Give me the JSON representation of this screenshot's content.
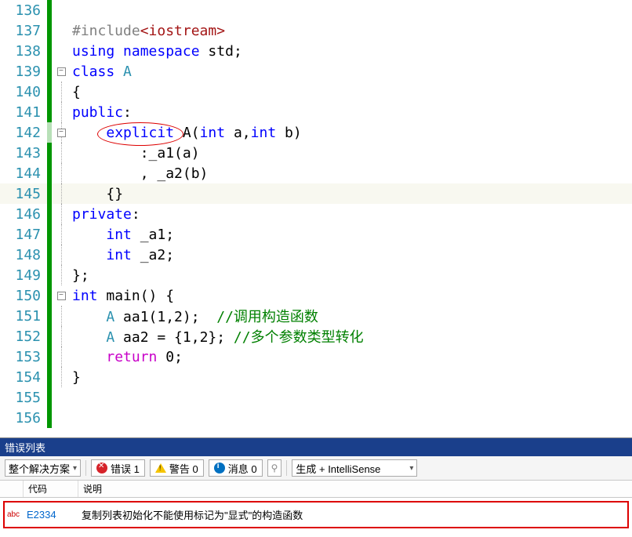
{
  "lines": {
    "l136": "136",
    "l137": "137",
    "l138": "138",
    "l139": "139",
    "l140": "140",
    "l141": "141",
    "l142": "142",
    "l143": "143",
    "l144": "144",
    "l145": "145",
    "l146": "146",
    "l147": "147",
    "l148": "148",
    "l149": "149",
    "l150": "150",
    "l151": "151",
    "l152": "152",
    "l153": "153",
    "l154": "154",
    "l155": "155",
    "l156": "156"
  },
  "code": {
    "include_hash": "#include",
    "include_hdr": "<iostream>",
    "using": "using",
    "namespace": "namespace",
    "std": "std",
    "semi": ";",
    "class_kw": "class",
    "class_name": "A",
    "lbrace": "{",
    "rbrace": "}",
    "public_kw": "public",
    "colon": ":",
    "explicit_kw": "explicit",
    "ctor_name": "A",
    "lparen": "(",
    "int_kw": "int",
    "p1": "a",
    "comma": ",",
    "p2": "b",
    "rparen": ")",
    "init1": ":_a1(a)",
    "init2": ", _a2(b)",
    "empty_braces": "{}",
    "private_kw": "private",
    "mem1": "int _a1;",
    "mem2": "int _a2;",
    "class_end": "};",
    "main_sig_int": "int",
    "main_name": "main",
    "main_parens": "() {",
    "aa1_decl": "A aa1(1,2);  ",
    "aa1_comment": "//调用构造函数",
    "aa2_decl": "A aa2 = {1,2}; ",
    "aa2_comment": "//多个参数类型转化",
    "return_kw": "return",
    "zero": "0",
    "semi2": ";"
  },
  "errorList": {
    "title": "错误列表",
    "scopeCombo": "整个解决方案",
    "errBtn": "错误 1",
    "warnBtn": "警告 0",
    "msgBtn": "消息 0",
    "buildCombo": "生成 + IntelliSense",
    "headers": {
      "code": "代码",
      "desc": "说明"
    },
    "row": {
      "abc": "abc",
      "code": "E2334",
      "desc": "复制列表初始化不能使用标记为\"显式\"的构造函数"
    }
  },
  "glyphs": {
    "minus": "−"
  }
}
